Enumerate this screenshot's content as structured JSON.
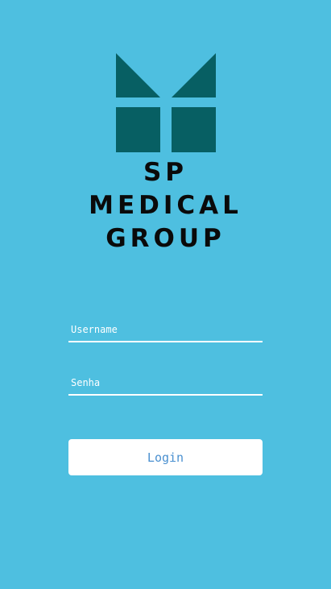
{
  "brand": {
    "line1": "SP",
    "line2": "MEDICAL",
    "line3": "GROUP",
    "logo_color": "#075f63"
  },
  "form": {
    "username_placeholder": "Username",
    "username_value": "",
    "password_placeholder": "Senha",
    "password_value": "",
    "login_label": "Login"
  },
  "colors": {
    "background": "#4ebfe0",
    "button_text": "#4a90d0",
    "brand_text": "#0a0a0a"
  }
}
